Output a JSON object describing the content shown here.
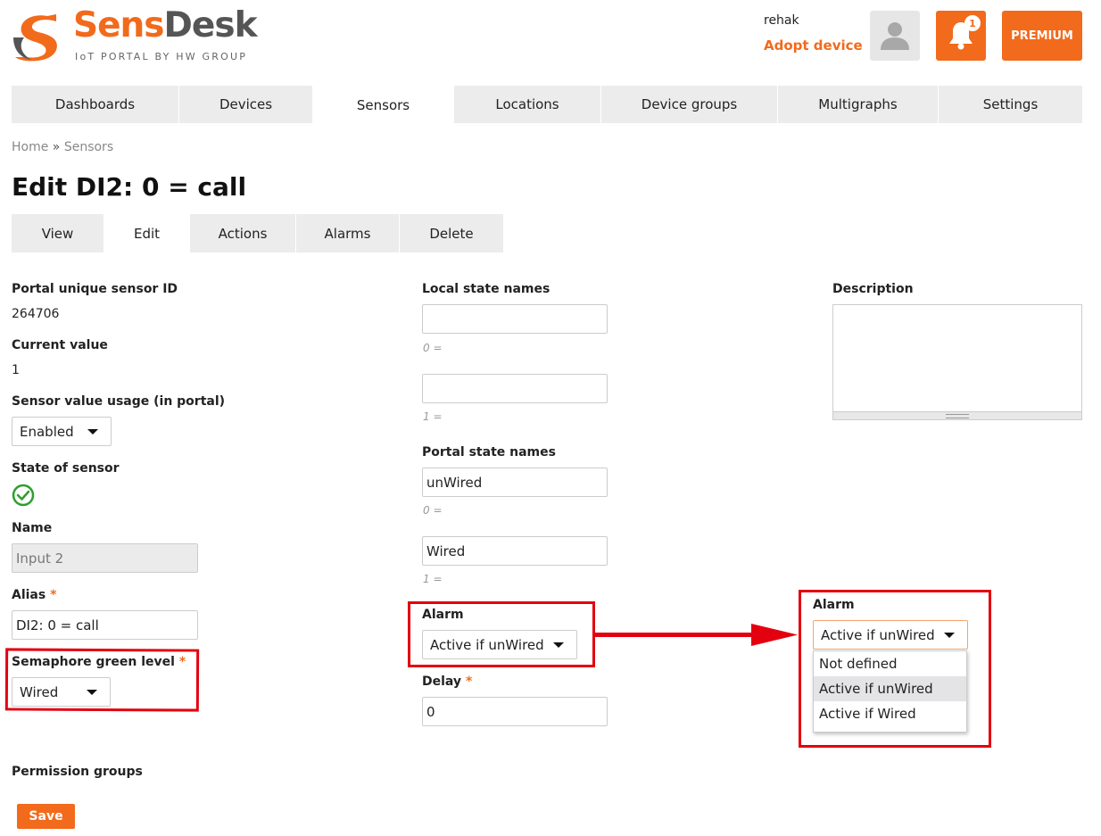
{
  "header": {
    "logo_part1": "Sens",
    "logo_part2": "Desk",
    "logo_subtitle": "IoT PORTAL BY HW GROUP",
    "username": "rehak",
    "adopt_link": "Adopt device",
    "notification_count": "1",
    "premium_label": "PREMIUM"
  },
  "nav": {
    "items": [
      {
        "label": "Dashboards"
      },
      {
        "label": "Devices"
      },
      {
        "label": "Sensors",
        "active": true
      },
      {
        "label": "Locations"
      },
      {
        "label": "Device groups"
      },
      {
        "label": "Multigraphs"
      },
      {
        "label": "Settings"
      }
    ]
  },
  "breadcrumb": {
    "home": "Home",
    "separator": "»",
    "current": "Sensors"
  },
  "page_title": "Edit DI2: 0 = call",
  "subtabs": [
    {
      "label": "View"
    },
    {
      "label": "Edit",
      "active": true
    },
    {
      "label": "Actions"
    },
    {
      "label": "Alarms"
    },
    {
      "label": "Delete"
    }
  ],
  "left": {
    "sensor_id_label": "Portal unique sensor ID",
    "sensor_id_value": "264706",
    "current_value_label": "Current value",
    "current_value": "1",
    "usage_label": "Sensor value usage (in portal)",
    "usage_value": "Enabled",
    "state_label": "State of sensor",
    "state_icon": "check-circle-icon",
    "name_label": "Name",
    "name_placeholder": "Input 2",
    "alias_label": "Alias",
    "alias_value": "DI2: 0 = call",
    "semaphore_label": "Semaphore green level",
    "semaphore_value": "Wired",
    "required_mark": "*",
    "permission_label": "Permission groups"
  },
  "middle": {
    "local_names_label": "Local state names",
    "local_0_value": "",
    "local_0_hint": "0 =",
    "local_1_value": "",
    "local_1_hint": "1 =",
    "portal_names_label": "Portal state names",
    "portal_0_value": "unWired",
    "portal_0_hint": "0 =",
    "portal_1_value": "Wired",
    "portal_1_hint": "1 =",
    "alarm_label": "Alarm",
    "alarm_value": "Active if unWired",
    "delay_label": "Delay",
    "delay_value": "0"
  },
  "right": {
    "description_label": "Description",
    "description_value": "",
    "alarm_label": "Alarm",
    "alarm_value": "Active if unWired",
    "options": [
      "Not defined",
      "Active if unWired",
      "Active if Wired"
    ],
    "selected_option": "Active if unWired"
  },
  "save_label": "Save",
  "colors": {
    "accent": "#f26a1b",
    "annotation": "#e3000f",
    "check": "#2e9e2e"
  }
}
